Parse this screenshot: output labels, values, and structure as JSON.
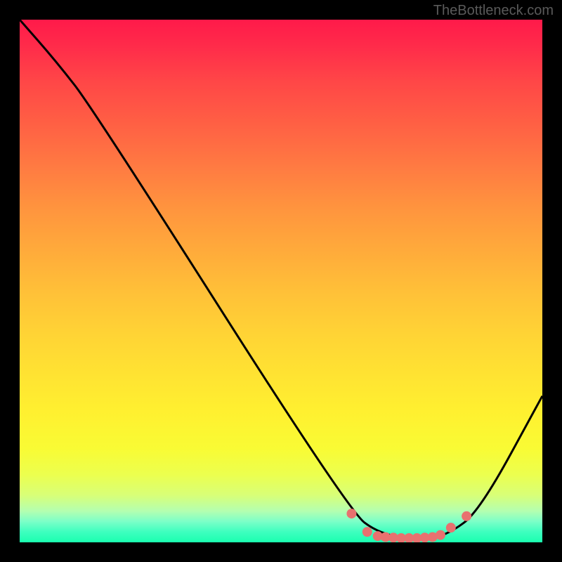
{
  "watermark": "TheBottleneck.com",
  "chart_data": {
    "type": "line",
    "title": "",
    "xlabel": "",
    "ylabel": "",
    "xlim": [
      0,
      1
    ],
    "ylim": [
      0,
      1
    ],
    "series": [
      {
        "name": "curve",
        "x": [
          0.0,
          0.07,
          0.14,
          0.63,
          0.69,
          0.77,
          0.82,
          0.88,
          1.0
        ],
        "y": [
          1.0,
          0.92,
          0.83,
          0.06,
          0.015,
          0.005,
          0.015,
          0.06,
          0.28
        ]
      }
    ],
    "dots": {
      "x": [
        0.635,
        0.665,
        0.685,
        0.7,
        0.715,
        0.73,
        0.745,
        0.76,
        0.775,
        0.79,
        0.805,
        0.825,
        0.855
      ],
      "y": [
        0.055,
        0.02,
        0.012,
        0.01,
        0.009,
        0.008,
        0.008,
        0.008,
        0.009,
        0.01,
        0.014,
        0.028,
        0.05
      ]
    },
    "background_gradient": {
      "top": "#ff1a4a",
      "mid": "#ffe332",
      "bottom": "#1affb0"
    },
    "curve_color": "#000000",
    "dot_color": "#e8716f"
  }
}
